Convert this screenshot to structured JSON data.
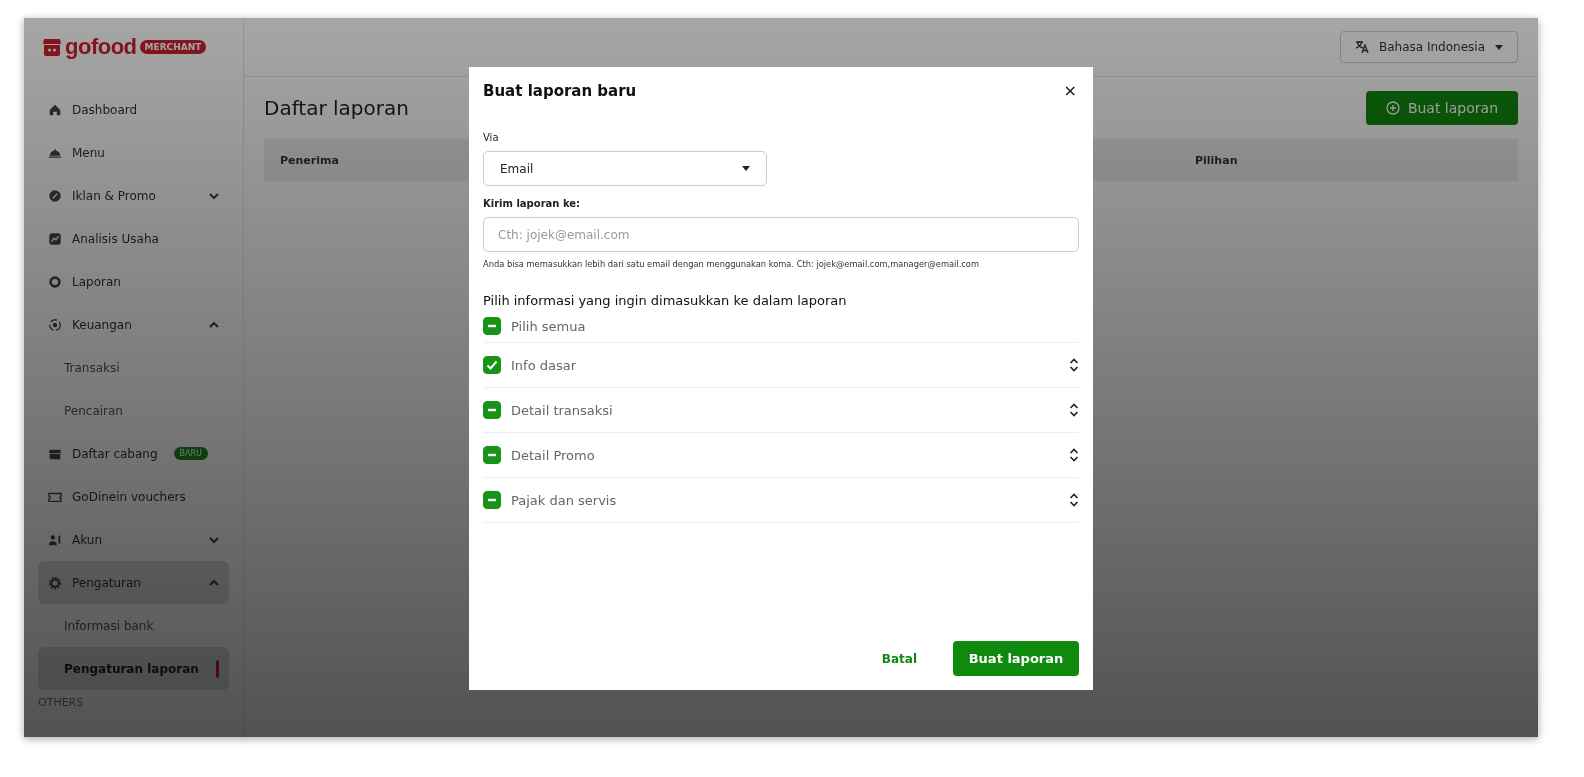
{
  "logo": {
    "name": "gofood",
    "badge": "MERCHANT"
  },
  "sidebar": {
    "items": [
      {
        "kind": "item",
        "label": "Dashboard",
        "selected": false
      },
      {
        "kind": "item",
        "label": "Menu",
        "selected": false
      },
      {
        "kind": "group",
        "label": "Iklan & Promo",
        "expanded": false,
        "selected": false
      },
      {
        "kind": "item",
        "label": "Analisis Usaha",
        "selected": false
      },
      {
        "kind": "item",
        "label": "Laporan",
        "selected": false
      },
      {
        "kind": "group",
        "label": "Keuangan",
        "expanded": true,
        "selected": false
      },
      {
        "kind": "subitem",
        "label": "Transaksi",
        "selected": false
      },
      {
        "kind": "subitem",
        "label": "Pencairan",
        "selected": false
      },
      {
        "kind": "item",
        "label": "Daftar cabang",
        "badge": "BARU",
        "selected": false
      },
      {
        "kind": "item",
        "label": "GoDinein vouchers",
        "selected": false
      },
      {
        "kind": "group",
        "label": "Akun",
        "expanded": false,
        "selected": false
      },
      {
        "kind": "group",
        "label": "Pengaturan",
        "expanded": true,
        "selected": true
      },
      {
        "kind": "subitem",
        "label": "Informasi bank",
        "selected": false
      },
      {
        "kind": "subitem",
        "label": "Pengaturan laporan",
        "selected": true
      },
      {
        "kind": "section",
        "label": "OTHERS"
      }
    ]
  },
  "language": {
    "label": "Bahasa Indonesia"
  },
  "page": {
    "title": "Daftar laporan",
    "action": "Buat laporan"
  },
  "table": {
    "columns": [
      "Penerima",
      "Pilihan"
    ]
  },
  "dialog": {
    "title": "Buat laporan baru",
    "close": "×",
    "via": {
      "label": "Via",
      "value": "Email"
    },
    "recipient": {
      "label": "Kirim laporan ke:",
      "placeholder": "Cth: jojek@email.com",
      "hint": "Anda bisa memasukkan lebih dari satu email dengan menggunakan koma. Cth: jojek@email.com,manager@email.com"
    },
    "section": "Pilih informasi yang ingin dimasukkan ke dalam laporan",
    "select_all": {
      "label": "Pilih semua",
      "checked": true,
      "indeterminate": true
    },
    "options": [
      {
        "label": "Info dasar",
        "checked": true,
        "indeterminate": false
      },
      {
        "label": "Detail transaksi",
        "checked": true,
        "indeterminate": true
      },
      {
        "label": "Detail Promo",
        "checked": true,
        "indeterminate": true
      },
      {
        "label": "Pajak dan servis",
        "checked": true,
        "indeterminate": true
      }
    ],
    "cancel": "Batal",
    "submit": "Buat laporan"
  }
}
